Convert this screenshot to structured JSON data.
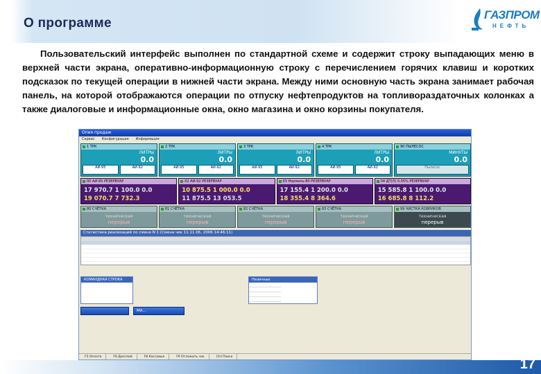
{
  "slide": {
    "title": "О программе",
    "logo_text": "ГАЗПРОМ",
    "logo_sub": "НЕФТЬ",
    "paragraph": "Пользовательский интерфейс выполнен по стандартной схеме и содержит строку выпадающих меню в верхней части экрана, оперативно-информационную строку с перечислением горячих клавиш и коротких подсказок по текущей операции в нижней части экрана. Между ними основную часть экрана занимает рабочая панель, на которой отображаются операции по отпуску нефтепродуктов на топливораздаточных колонках а также  диалоговые и информационные окна, окно магазина и окно корзины покупателя.",
    "page_number": "17"
  },
  "app": {
    "window_title": "Опия продаж",
    "menu": [
      "Сервис",
      "Конфигурация",
      "Информация"
    ],
    "pumps": [
      {
        "label": "1 ТРК",
        "unit": "ЛИТРЫ",
        "value": "0.0",
        "fuels": [
          "АИ-95",
          "АИ-92"
        ]
      },
      {
        "label": "2 ТРК",
        "unit": "ЛИТРЫ",
        "value": "0.0",
        "fuels": [
          "АИ-95",
          "АИ-92"
        ]
      },
      {
        "label": "3 ТРК",
        "unit": "ЛИТРЫ",
        "value": "0.0",
        "fuels": [
          "АИ-95",
          "АИ-92"
        ]
      },
      {
        "label": "4 ТРК",
        "unit": "ЛИТРЫ",
        "value": "0.0",
        "fuels": [
          "АИ-95",
          "АИ-92"
        ]
      },
      {
        "label": "90 ПЫЛЕСОС",
        "unit": "МИНУТЫ",
        "value": "0.0",
        "fuels": [
          "Пылесос"
        ]
      }
    ],
    "tanks": [
      {
        "label": "00 АИ-95 РЕЗЕРВУАР",
        "row1": "17 970.7  1 100.0  0.0",
        "row2": "19 070.7  7 732.3"
      },
      {
        "label": "02 АИ-92 РЕЗЕРВУАР",
        "row1": "10 875.5  1 000.0  0.0",
        "row2": "11 875.5  13 053.5"
      },
      {
        "label": "03 Нормаль-80 РЕЗЕРВУАР",
        "row1": "17 155.4  1 200.0  0.0",
        "row2": "18 355.4  8 364.6"
      },
      {
        "label": "04 ДТ(Л) 0.05% РЕЗЕРВУАР",
        "row1": "15 585.8  1 100.0  0.0",
        "row2": "16 685.8  8 112.2"
      }
    ],
    "counters": [
      {
        "label": "80 СЧЁТКА",
        "line1": "техническая",
        "line2": "перерыв"
      },
      {
        "label": "81 СЧЁТКА",
        "line1": "техническая",
        "line2": "перерыв"
      },
      {
        "label": "82 СЧЁТКА",
        "line1": "техническая",
        "line2": "перерыв"
      },
      {
        "label": "83 СЧЁТКА",
        "line1": "техническая",
        "line2": "перерыв"
      },
      {
        "label": "99 ЧИСТКА КОВРИКОВ",
        "line1": "техническая",
        "line2": "перерыв"
      }
    ],
    "grid_title": "Статистика реализаций по смене N 1 (Смена чек 11.11.06, 2006 14:46:11)",
    "command_title": "КОМАНДНАЯ СТРОКА",
    "info_title": "Наличные",
    "taskbar": [
      "",
      "МА..."
    ],
    "status_items": [
      "F5 Оплата",
      "F6 Дисплей",
      "F8 Кассовые",
      "F9 Отложить чек",
      "Ctrl Поиск"
    ],
    "colors": {
      "pump": "#1c9fb8",
      "tank": "#4a1a70",
      "counter": "#7f9a9c",
      "titlebar": "#0a3cb0",
      "accent": "#1a7cc4"
    }
  }
}
